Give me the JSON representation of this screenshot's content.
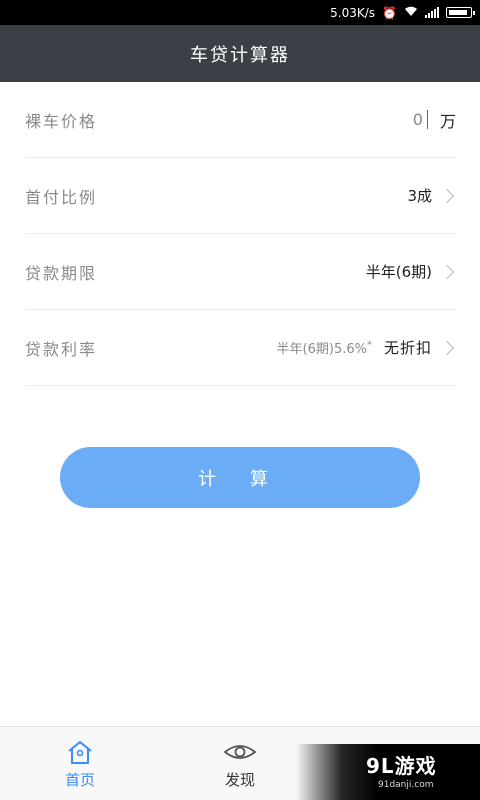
{
  "status_bar": {
    "speed": "5.03K/s"
  },
  "header": {
    "title": "车贷计算器"
  },
  "form": {
    "price": {
      "label": "裸车价格",
      "value": "0",
      "unit": "万"
    },
    "down_payment": {
      "label": "首付比例",
      "value": "3成"
    },
    "term": {
      "label": "贷款期限",
      "value": "半年(6期)"
    },
    "rate": {
      "label": "贷款利率",
      "detail": "半年(6期)5.6%",
      "mark": "*",
      "value": "无折扣"
    }
  },
  "calculate_label": "计 算",
  "tabs": [
    {
      "label": "首页",
      "active": true
    },
    {
      "label": "发现",
      "active": false
    }
  ],
  "watermark": {
    "brand": "9L游戏",
    "site": "91danji.com"
  },
  "colors": {
    "header_bg": "#3b3f46",
    "accent": "#3a8df2",
    "button": "#6aacf6"
  }
}
